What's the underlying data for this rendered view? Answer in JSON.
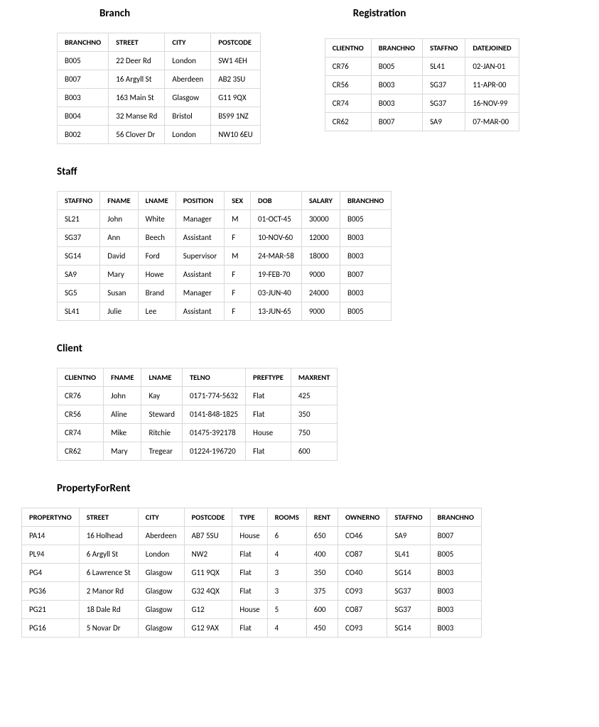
{
  "branch": {
    "title": "Branch",
    "columns": [
      "BRANCHNO",
      "STREET",
      "CITY",
      "POSTCODE"
    ],
    "rows": [
      [
        "B005",
        "22 Deer Rd",
        "London",
        "SW1 4EH"
      ],
      [
        "B007",
        "16 Argyll St",
        "Aberdeen",
        "AB2 3SU"
      ],
      [
        "B003",
        "163 Main St",
        "Glasgow",
        "G11 9QX"
      ],
      [
        "B004",
        "32 Manse Rd",
        "Bristol",
        "BS99 1NZ"
      ],
      [
        "B002",
        "56 Clover Dr",
        "London",
        "NW10 6EU"
      ]
    ]
  },
  "registration": {
    "title": "Registration",
    "columns": [
      "CLIENTNO",
      "BRANCHNO",
      "STAFFNO",
      "DATEJOINED"
    ],
    "rows": [
      [
        "CR76",
        "B005",
        "SL41",
        "02-JAN-01"
      ],
      [
        "CR56",
        "B003",
        "SG37",
        "11-APR-00"
      ],
      [
        "CR74",
        "B003",
        "SG37",
        "16-NOV-99"
      ],
      [
        "CR62",
        "B007",
        "SA9",
        "07-MAR-00"
      ]
    ]
  },
  "staff": {
    "title": "Staff",
    "columns": [
      "STAFFNO",
      "FNAME",
      "LNAME",
      "POSITION",
      "SEX",
      "DOB",
      "SALARY",
      "BRANCHNO"
    ],
    "rows": [
      [
        "SL21",
        "John",
        "White",
        "Manager",
        "M",
        "01-OCT-45",
        "30000",
        "B005"
      ],
      [
        "SG37",
        "Ann",
        "Beech",
        "Assistant",
        "F",
        "10-NOV-60",
        "12000",
        "B003"
      ],
      [
        "SG14",
        "David",
        "Ford",
        "Supervisor",
        "M",
        "24-MAR-58",
        "18000",
        "B003"
      ],
      [
        "SA9",
        "Mary",
        "Howe",
        "Assistant",
        "F",
        "19-FEB-70",
        "9000",
        "B007"
      ],
      [
        "SG5",
        "Susan",
        "Brand",
        "Manager",
        "F",
        "03-JUN-40",
        "24000",
        "B003"
      ],
      [
        "SL41",
        "Julie",
        "Lee",
        "Assistant",
        "F",
        "13-JUN-65",
        "9000",
        "B005"
      ]
    ]
  },
  "client": {
    "title": "Client",
    "columns": [
      "CLIENTNO",
      "FNAME",
      "LNAME",
      "TELNO",
      "PREFTYPE",
      "MAXRENT"
    ],
    "rows": [
      [
        "CR76",
        "John",
        "Kay",
        "0171-774-5632",
        "Flat",
        "425"
      ],
      [
        "CR56",
        "Aline",
        "Steward",
        "0141-848-1825",
        "Flat",
        "350"
      ],
      [
        "CR74",
        "Mike",
        "Ritchie",
        "01475-392178",
        "House",
        "750"
      ],
      [
        "CR62",
        "Mary",
        "Tregear",
        "01224-196720",
        "Flat",
        "600"
      ]
    ]
  },
  "property": {
    "title": "PropertyForRent",
    "columns": [
      "PROPERTYNO",
      "STREET",
      "CITY",
      "POSTCODE",
      "TYPE",
      "ROOMS",
      "RENT",
      "OWNERNO",
      "STAFFNO",
      "BRANCHNO"
    ],
    "rows": [
      [
        "PA14",
        "16 Holhead",
        "Aberdeen",
        "AB7 5SU",
        "House",
        "6",
        "650",
        "CO46",
        "SA9",
        "B007"
      ],
      [
        "PL94",
        "6 Argyll St",
        "London",
        "NW2",
        "Flat",
        "4",
        "400",
        "CO87",
        "SL41",
        "B005"
      ],
      [
        "PG4",
        "6 Lawrence St",
        "Glasgow",
        "G11 9QX",
        "Flat",
        "3",
        "350",
        "CO40",
        "SG14",
        "B003"
      ],
      [
        "PG36",
        "2 Manor Rd",
        "Glasgow",
        "G32 4QX",
        "Flat",
        "3",
        "375",
        "CO93",
        "SG37",
        "B003"
      ],
      [
        "PG21",
        "18 Dale Rd",
        "Glasgow",
        "G12",
        "House",
        "5",
        "600",
        "CO87",
        "SG37",
        "B003"
      ],
      [
        "PG16",
        "5 Novar Dr",
        "Glasgow",
        "G12 9AX",
        "Flat",
        "4",
        "450",
        "CO93",
        "SG14",
        "B003"
      ]
    ]
  }
}
